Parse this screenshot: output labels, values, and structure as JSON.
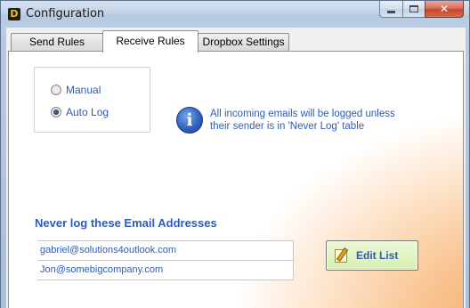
{
  "window": {
    "title": "Configuration",
    "app_icon_letter": "D"
  },
  "tabs": [
    {
      "label": "Send Rules",
      "active": false
    },
    {
      "label": "Receive Rules",
      "active": true
    },
    {
      "label": "Dropbox Settings",
      "active": false
    }
  ],
  "mode": {
    "options": [
      {
        "label": "Manual",
        "checked": false
      },
      {
        "label": "Auto Log",
        "checked": true
      }
    ]
  },
  "info": {
    "icon": "info-icon",
    "line1": "All incoming emails will be logged unless",
    "line2": "their sender is in 'Never Log' table"
  },
  "never_log": {
    "title": "Never log these Email Addresses",
    "addresses": [
      "gabriel@solutions4outlook.com",
      "Jon@somebigcompany.com"
    ],
    "edit_label": "Edit List"
  },
  "colors": {
    "label_blue": "#2e5bb8",
    "button_green": "#d6efb0",
    "accent_orange": "#f6a85c"
  }
}
